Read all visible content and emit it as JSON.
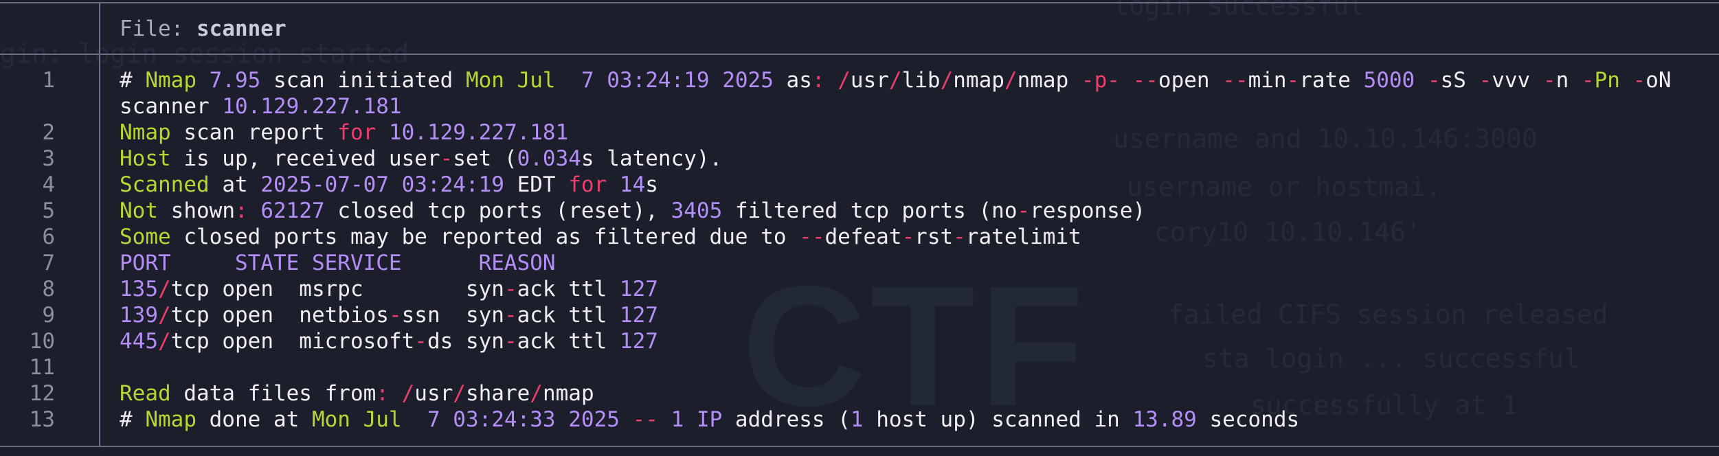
{
  "header": {
    "prefix": "File: ",
    "filename": "scanner"
  },
  "line_numbers": [
    "1",
    "2",
    "3",
    "4",
    "5",
    "6",
    "7",
    "8",
    "9",
    "10",
    "11",
    "12",
    "13"
  ],
  "wallpaper": {
    "logo_text": "CTF",
    "ghost_lines": [
      "login successful",
      "gin: login session started",
      "username and 10.10.146:3000",
      "username or hostmai.",
      "cory10 10.10.146'",
      "failed CIFS session released",
      "sta login ... successful",
      "successfully at 1"
    ]
  },
  "file_lines": [
    [
      {
        "t": "# ",
        "c": "w"
      },
      {
        "t": "Nmap",
        "c": "y"
      },
      {
        "t": " ",
        "c": "w"
      },
      {
        "t": "7.95",
        "c": "p"
      },
      {
        "t": " scan initiated ",
        "c": "w"
      },
      {
        "t": "Mon Jul",
        "c": "y"
      },
      {
        "t": "  ",
        "c": "w"
      },
      {
        "t": "7 03:24:19 2025",
        "c": "p"
      },
      {
        "t": " as",
        "c": "w"
      },
      {
        "t": ":",
        "c": "r"
      },
      {
        "t": " ",
        "c": "w"
      },
      {
        "t": "/",
        "c": "r"
      },
      {
        "t": "usr",
        "c": "w"
      },
      {
        "t": "/",
        "c": "r"
      },
      {
        "t": "lib",
        "c": "w"
      },
      {
        "t": "/",
        "c": "r"
      },
      {
        "t": "nmap",
        "c": "w"
      },
      {
        "t": "/",
        "c": "r"
      },
      {
        "t": "nmap ",
        "c": "w"
      },
      {
        "t": "-p-",
        "c": "r"
      },
      {
        "t": " ",
        "c": "w"
      },
      {
        "t": "--",
        "c": "r"
      },
      {
        "t": "open ",
        "c": "w"
      },
      {
        "t": "--",
        "c": "r"
      },
      {
        "t": "min",
        "c": "w"
      },
      {
        "t": "-",
        "c": "r"
      },
      {
        "t": "rate ",
        "c": "w"
      },
      {
        "t": "5000",
        "c": "p"
      },
      {
        "t": " ",
        "c": "w"
      },
      {
        "t": "-",
        "c": "r"
      },
      {
        "t": "sS ",
        "c": "w"
      },
      {
        "t": "-",
        "c": "r"
      },
      {
        "t": "vvv ",
        "c": "w"
      },
      {
        "t": "-",
        "c": "r"
      },
      {
        "t": "n ",
        "c": "w"
      },
      {
        "t": "-",
        "c": "r"
      },
      {
        "t": "Pn",
        "c": "y"
      },
      {
        "t": " ",
        "c": "w"
      },
      {
        "t": "-",
        "c": "r"
      },
      {
        "t": "oN",
        "c": "w"
      }
    ],
    [
      {
        "t": "scanner ",
        "c": "w"
      },
      {
        "t": "10.129.227.181",
        "c": "p"
      }
    ],
    [
      {
        "t": "Nmap",
        "c": "y"
      },
      {
        "t": " scan report ",
        "c": "w"
      },
      {
        "t": "for",
        "c": "r"
      },
      {
        "t": " ",
        "c": "w"
      },
      {
        "t": "10.129.227.181",
        "c": "p"
      }
    ],
    [
      {
        "t": "Host",
        "c": "y"
      },
      {
        "t": " is up, received user",
        "c": "w"
      },
      {
        "t": "-",
        "c": "r"
      },
      {
        "t": "set (",
        "c": "w"
      },
      {
        "t": "0.034",
        "c": "p"
      },
      {
        "t": "s latency).",
        "c": "w"
      }
    ],
    [
      {
        "t": "Scanned",
        "c": "y"
      },
      {
        "t": " at ",
        "c": "w"
      },
      {
        "t": "2025-07-07 03:24:19",
        "c": "p"
      },
      {
        "t": " EDT ",
        "c": "w"
      },
      {
        "t": "for",
        "c": "r"
      },
      {
        "t": " ",
        "c": "w"
      },
      {
        "t": "14",
        "c": "p"
      },
      {
        "t": "s",
        "c": "w"
      }
    ],
    [
      {
        "t": "Not",
        "c": "y"
      },
      {
        "t": " shown",
        "c": "w"
      },
      {
        "t": ":",
        "c": "r"
      },
      {
        "t": " ",
        "c": "w"
      },
      {
        "t": "62127",
        "c": "p"
      },
      {
        "t": " closed tcp ports (reset), ",
        "c": "w"
      },
      {
        "t": "3405",
        "c": "p"
      },
      {
        "t": " filtered tcp ports (no",
        "c": "w"
      },
      {
        "t": "-",
        "c": "r"
      },
      {
        "t": "response)",
        "c": "w"
      }
    ],
    [
      {
        "t": "Some",
        "c": "y"
      },
      {
        "t": " closed ports may be reported as filtered due to ",
        "c": "w"
      },
      {
        "t": "--",
        "c": "r"
      },
      {
        "t": "defeat",
        "c": "w"
      },
      {
        "t": "-",
        "c": "r"
      },
      {
        "t": "rst",
        "c": "w"
      },
      {
        "t": "-",
        "c": "r"
      },
      {
        "t": "ratelimit",
        "c": "w"
      }
    ],
    [
      {
        "t": "PORT     STATE SERVICE      REASON",
        "c": "p"
      }
    ],
    [
      {
        "t": "135",
        "c": "p"
      },
      {
        "t": "/",
        "c": "r"
      },
      {
        "t": "tcp open  msrpc        syn",
        "c": "w"
      },
      {
        "t": "-",
        "c": "r"
      },
      {
        "t": "ack ttl ",
        "c": "w"
      },
      {
        "t": "127",
        "c": "p"
      }
    ],
    [
      {
        "t": "139",
        "c": "p"
      },
      {
        "t": "/",
        "c": "r"
      },
      {
        "t": "tcp open  netbios",
        "c": "w"
      },
      {
        "t": "-",
        "c": "r"
      },
      {
        "t": "ssn  syn",
        "c": "w"
      },
      {
        "t": "-",
        "c": "r"
      },
      {
        "t": "ack ttl ",
        "c": "w"
      },
      {
        "t": "127",
        "c": "p"
      }
    ],
    [
      {
        "t": "445",
        "c": "p"
      },
      {
        "t": "/",
        "c": "r"
      },
      {
        "t": "tcp open  microsoft",
        "c": "w"
      },
      {
        "t": "-",
        "c": "r"
      },
      {
        "t": "ds syn",
        "c": "w"
      },
      {
        "t": "-",
        "c": "r"
      },
      {
        "t": "ack ttl ",
        "c": "w"
      },
      {
        "t": "127",
        "c": "p"
      }
    ],
    [],
    [
      {
        "t": "Read",
        "c": "y"
      },
      {
        "t": " data files from",
        "c": "w"
      },
      {
        "t": ":",
        "c": "r"
      },
      {
        "t": " ",
        "c": "w"
      },
      {
        "t": "/",
        "c": "r"
      },
      {
        "t": "usr",
        "c": "w"
      },
      {
        "t": "/",
        "c": "r"
      },
      {
        "t": "share",
        "c": "w"
      },
      {
        "t": "/",
        "c": "r"
      },
      {
        "t": "nmap",
        "c": "w"
      }
    ],
    [
      {
        "t": "# ",
        "c": "w"
      },
      {
        "t": "Nmap",
        "c": "y"
      },
      {
        "t": " done at ",
        "c": "w"
      },
      {
        "t": "Mon Jul",
        "c": "y"
      },
      {
        "t": "  ",
        "c": "w"
      },
      {
        "t": "7 03:24:33 2025",
        "c": "p"
      },
      {
        "t": " ",
        "c": "w"
      },
      {
        "t": "--",
        "c": "r"
      },
      {
        "t": " ",
        "c": "w"
      },
      {
        "t": "1",
        "c": "p"
      },
      {
        "t": " ",
        "c": "w"
      },
      {
        "t": "IP",
        "c": "p"
      },
      {
        "t": " address (",
        "c": "w"
      },
      {
        "t": "1",
        "c": "p"
      },
      {
        "t": " host up) scanned in ",
        "c": "w"
      },
      {
        "t": "13.89",
        "c": "p"
      },
      {
        "t": " seconds",
        "c": "w"
      }
    ]
  ],
  "colors": {
    "background": "#1c1f2b",
    "border": "#6a6f85",
    "keyword_yellow": "#b7d634",
    "number_purple": "#b48ef7",
    "operator_red": "#ee3d6a",
    "text_white": "#eeeef4",
    "line_number": "#8a8ea0"
  }
}
